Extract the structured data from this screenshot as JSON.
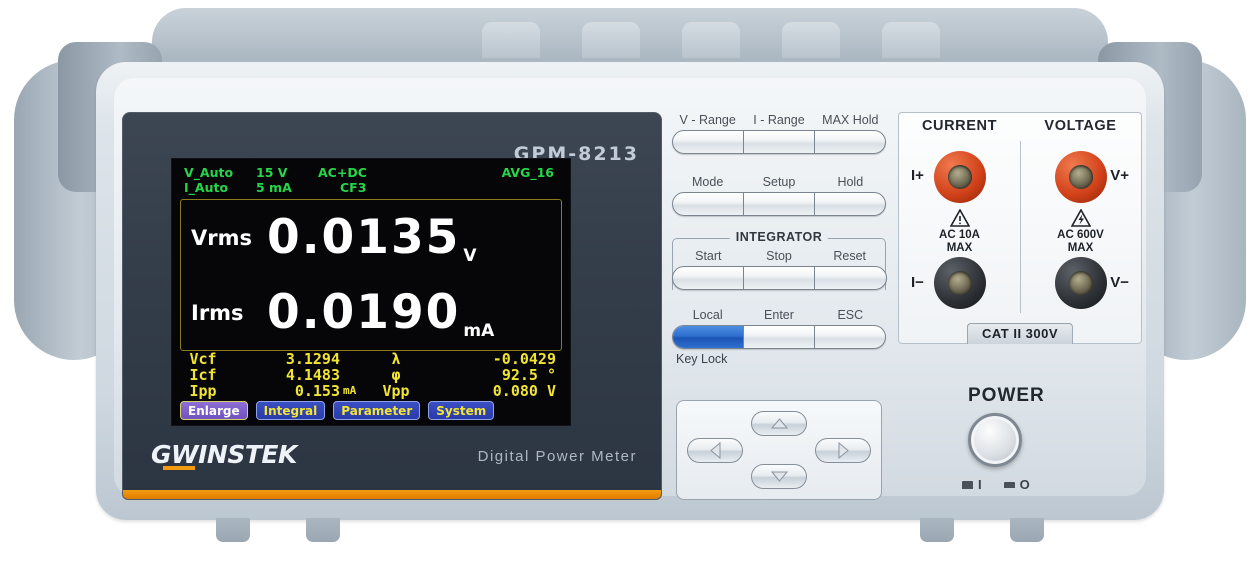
{
  "device": {
    "model": "GPM-8213",
    "brand_gw": "GW",
    "brand_instek": "INSTEK",
    "subtitle": "Digital  Power  Meter"
  },
  "display": {
    "header": {
      "v_mode": "V_Auto",
      "v_range": "15 V",
      "coupling": "AC+DC",
      "avg": "AVG_16",
      "i_mode": "I_Auto",
      "i_range": "5 mA",
      "crest": "CF3"
    },
    "primary": [
      {
        "label": "Vrms",
        "value": "0.0135",
        "unit": "V"
      },
      {
        "label": "Irms",
        "value": "0.0190",
        "unit": "mA"
      }
    ],
    "secondary": [
      {
        "label": "Vcf",
        "value": "3.1294",
        "unit": "",
        "label2": "λ",
        "value2": "-0.0429"
      },
      {
        "label": "Icf",
        "value": "4.1483",
        "unit": "",
        "label2": "φ",
        "value2": "92.5 °"
      },
      {
        "label": "Ipp",
        "value": "0.153",
        "unit": "mA",
        "label2": "Vpp",
        "value2": "0.080 V"
      }
    ],
    "softkeys": [
      {
        "label": "Enlarge",
        "selected": true
      },
      {
        "label": "Integral",
        "selected": false
      },
      {
        "label": "Parameter",
        "selected": false
      },
      {
        "label": "System",
        "selected": false
      }
    ],
    "colors": {
      "header_green": "#27d54a",
      "primary_white": "#ffffff",
      "secondary_yellow": "#f2e433",
      "box_border": "#8c7a1e",
      "softkey_blue": "#2a3ba8",
      "softkey_selected": "#8e6fd6"
    }
  },
  "keypad": {
    "row1": {
      "labels": [
        "V - Range",
        "I - Range",
        "MAX Hold"
      ]
    },
    "row2": {
      "labels": [
        "Mode",
        "Setup",
        "Hold"
      ]
    },
    "integrator": {
      "title": "INTEGRATOR",
      "labels": [
        "Start",
        "Stop",
        "Reset"
      ]
    },
    "row4": {
      "labels": [
        "Local",
        "Enter",
        "ESC"
      ],
      "sublabel": "Key Lock",
      "active_index": 0
    },
    "arrows": [
      "up",
      "left",
      "right",
      "down"
    ]
  },
  "terminals": {
    "headers": [
      "CURRENT",
      "VOLTAGE"
    ],
    "current": {
      "top_label": "I+",
      "bottom_label": "I−",
      "warning_line1": "AC 10A",
      "warning_line2": "MAX",
      "symbol": "exclamation"
    },
    "voltage": {
      "top_label": "V+",
      "bottom_label": "V−",
      "warning_line1": "AC 600V",
      "warning_line2": "MAX",
      "symbol": "high-voltage"
    },
    "category_badge": "CAT II  300V",
    "colors": {
      "positive_jack": "#d1411a",
      "negative_jack": "#2e3237"
    }
  },
  "power": {
    "label": "POWER",
    "mark_on": "I",
    "mark_off": "O"
  }
}
